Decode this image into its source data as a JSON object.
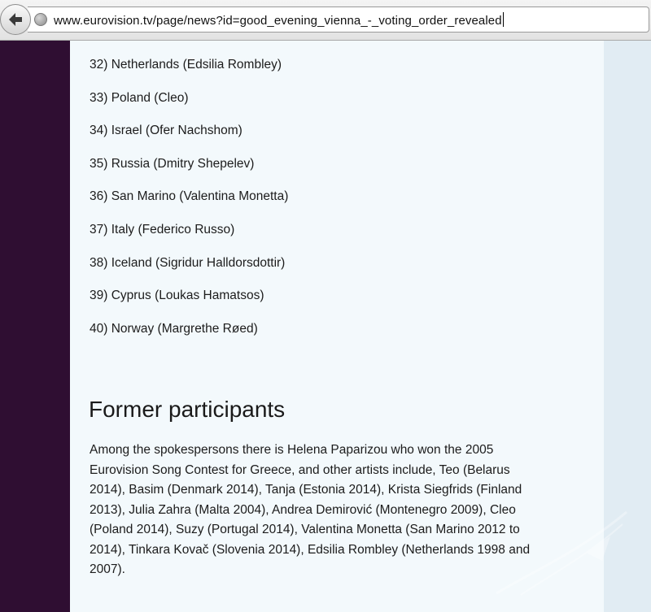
{
  "browser": {
    "url": "www.eurovision.tv/page/news?id=good_evening_vienna_-_voting_order_revealed"
  },
  "voting_order": [
    "32) Netherlands (Edsilia Rombley)",
    "33) Poland (Cleo)",
    "34) Israel (Ofer Nachshom)",
    "35) Russia (Dmitry Shepelev)",
    "36) San Marino (Valentina Monetta)",
    "37) Italy (Federico Russo)",
    "38) Iceland (Sigridur Halldorsdottir)",
    "39) Cyprus (Loukas Hamatsos)",
    "40) Norway (Margrethe Røed)"
  ],
  "former_participants": {
    "heading": "Former participants",
    "lines": [
      "Among the spokespersons there is Helena Paparizou who won the 2005",
      "Eurovision Song Contest for Greece, and other artists include, Teo (Belarus",
      "2014), Basim (Denmark 2014), Tanja (Estonia 2014), Krista Siegfrids (Finland",
      "2013), Julia Zahra (Malta 2004), Andrea Demirović (Montenegro 2009), Cleo",
      "(Poland 2014), Suzy (Portugal 2014), Valentina Monetta (San Marino 2012 to",
      "2014), Tinkara Kovač (Slovenia 2014), Edsilia Rombley (Netherlands 1998 and",
      "2007)."
    ]
  },
  "colors": {
    "left_band": "#2f0e32",
    "content_bg": "#f3f9fc",
    "right_band": "#e1ecf3"
  },
  "icons": {
    "back": "back-arrow-icon",
    "site": "globe-icon",
    "watermark": "watermark-icon"
  }
}
